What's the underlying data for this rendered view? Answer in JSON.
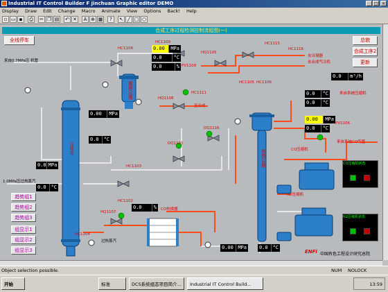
{
  "window": {
    "title": "Industrial IT Control Builder F jinchuan  Graphic editor  DEMO"
  },
  "menu": [
    "Display",
    "Draw",
    "Edit",
    "Change",
    "Macro",
    "Animate",
    "View",
    "Options",
    "Back!",
    "Help"
  ],
  "toolbar": {
    "icons": [
      "new",
      "open",
      "save",
      "print",
      "cut",
      "copy",
      "paste",
      "undo",
      "delete",
      "text",
      "zoom",
      "grid",
      "help"
    ]
  },
  "diagram": {
    "header": "合成工序过程检测控制流程图(一)",
    "emergency_button": "全线停车",
    "right_buttons": [
      "总貌",
      "合成工序2",
      "更新"
    ],
    "left_buttons": [
      "趋势组1",
      "趋势组2",
      "趋势组3",
      "组显示1",
      "组显示2",
      "组显示3"
    ],
    "tags": {
      "hc1108": "HC1108",
      "hc1109": "HC1109",
      "hc1115": "HC1115",
      "hc1116": "HC1116",
      "hq1105": "HQ1105",
      "pv1109": "PV1109",
      "hc1111": "HC1111",
      "hq1108": "HQ1108",
      "hc1105": "HC1105",
      "hc1106": "HC1106",
      "pv1106": "PV1106",
      "dq1115": "DQ1115",
      "dq1116": "DQ1116",
      "hc1103": "HC1103",
      "hc1102": "HC1102",
      "hq1107": "HQ1107",
      "hc1104": "HC1104"
    },
    "labels": {
      "feed": "来自0.7MPa压 机管",
      "ammonia_in": "1.0MPa压过热蒸汽",
      "to_tower1": "去冷凝器",
      "to_tower2": "去合成气冷机",
      "steam_out": "至合成",
      "to_heat": "去外界冷却",
      "to_valve": "来自系统CO气管",
      "co_gen": "CO压缩机",
      "co_gen2": "CO压缩机",
      "to_cooler": "CO热换器",
      "flash": "过热蒸汽",
      "n2_comp": "N2压缩机",
      "logo": "中国有色工程设计研究总院",
      "enfi": "ENFi",
      "col1": "冷却塔",
      "col2": "预热CO塔",
      "col3": "脱硫CO塔",
      "side1": "来自合成气CO",
      "side2": "来自合成气CO",
      "gauge1": "来自系统压缩机"
    },
    "readings": [
      {
        "id": "r1",
        "value": "0.00",
        "unit": "MPa",
        "hl": true
      },
      {
        "id": "r2",
        "value": "0.0",
        "unit": "°C",
        "hl": false
      },
      {
        "id": "r3",
        "value": "0.0",
        "unit": "%",
        "hl": false
      },
      {
        "id": "r4",
        "value": "0.00",
        "unit": "MPa",
        "hl": false
      },
      {
        "id": "r5",
        "value": "0.0",
        "unit": "°C",
        "hl": false
      },
      {
        "id": "r6",
        "value": "0.0",
        "unit": "MPa",
        "hl": false
      },
      {
        "id": "r7",
        "value": "0.0",
        "unit": "m³/h",
        "hl": false
      },
      {
        "id": "r8",
        "value": "0.0",
        "unit": "°C",
        "hl": false
      },
      {
        "id": "r9",
        "value": "0.0",
        "unit": "°C",
        "hl": false
      },
      {
        "id": "r10",
        "value": "0.00",
        "unit": "MPa",
        "hl": true
      },
      {
        "id": "r11",
        "value": "0.0",
        "unit": "°C",
        "hl": false
      },
      {
        "id": "r12",
        "value": "0.0",
        "unit": "%",
        "hl": false
      },
      {
        "id": "r13",
        "value": "0.00",
        "unit": "MPa",
        "hl": false
      },
      {
        "id": "r14",
        "value": "0.0",
        "unit": "°C",
        "hl": false
      },
      {
        "id": "r15",
        "value": "0.0",
        "unit": "°C",
        "hl": false
      }
    ],
    "status_rows": {
      "co_comp": "CO压缩机状态",
      "n2_comp": "N2压缩机状态",
      "co_comp2": "CO压缩机状态2",
      "n2_comp2": "N2压缩机状态2"
    }
  },
  "statusbar": {
    "text": "Object selection possible.",
    "num": "NUM",
    "nolock": "NOLOCK"
  },
  "taskbar": {
    "start": "开始",
    "items": [
      "标准",
      "DCS系统组态项目简介...",
      "Industrial IT Control Build..."
    ],
    "clock": "13:59"
  }
}
